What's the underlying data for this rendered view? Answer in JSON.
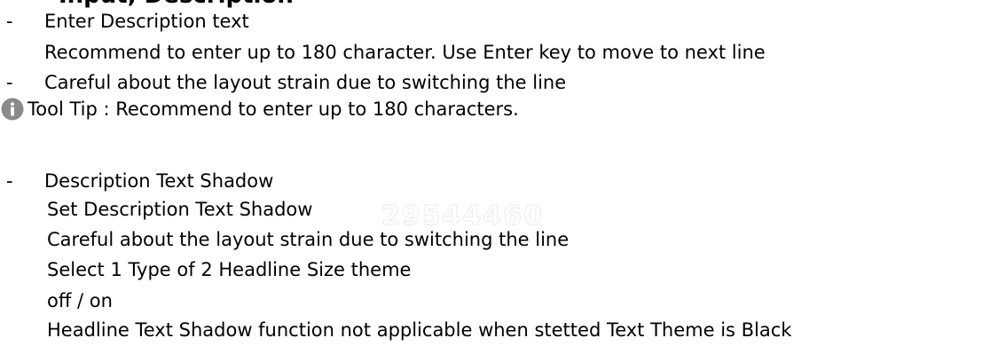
{
  "heading": "Input, Description",
  "lines": {
    "enter_description": "Enter Description text",
    "recommend_180": "Recommend to enter up to 180 character. Use Enter key to move to next line",
    "careful_layout_1": "Careful about the layout strain due to switching the line",
    "tooltip": "Tool Tip : Recommend to enter up to 180 characters.",
    "shadow_title": "Description Text Shadow",
    "set_shadow": "Set Description Text Shadow",
    "careful_layout_2": "Careful about the layout strain due to switching the line",
    "select_type": "Select 1 Type of 2 Headline Size theme",
    "off_on": "off / on",
    "not_applicable": "Headline Text Shadow function not applicable when stetted Text Theme is Black"
  },
  "bullet": "-",
  "watermark": "29544460",
  "colors": {
    "text": "#000000",
    "info_icon": "#8a8a8a",
    "background": "#ffffff"
  },
  "icons": {
    "tooltip_icon": "info-icon"
  }
}
